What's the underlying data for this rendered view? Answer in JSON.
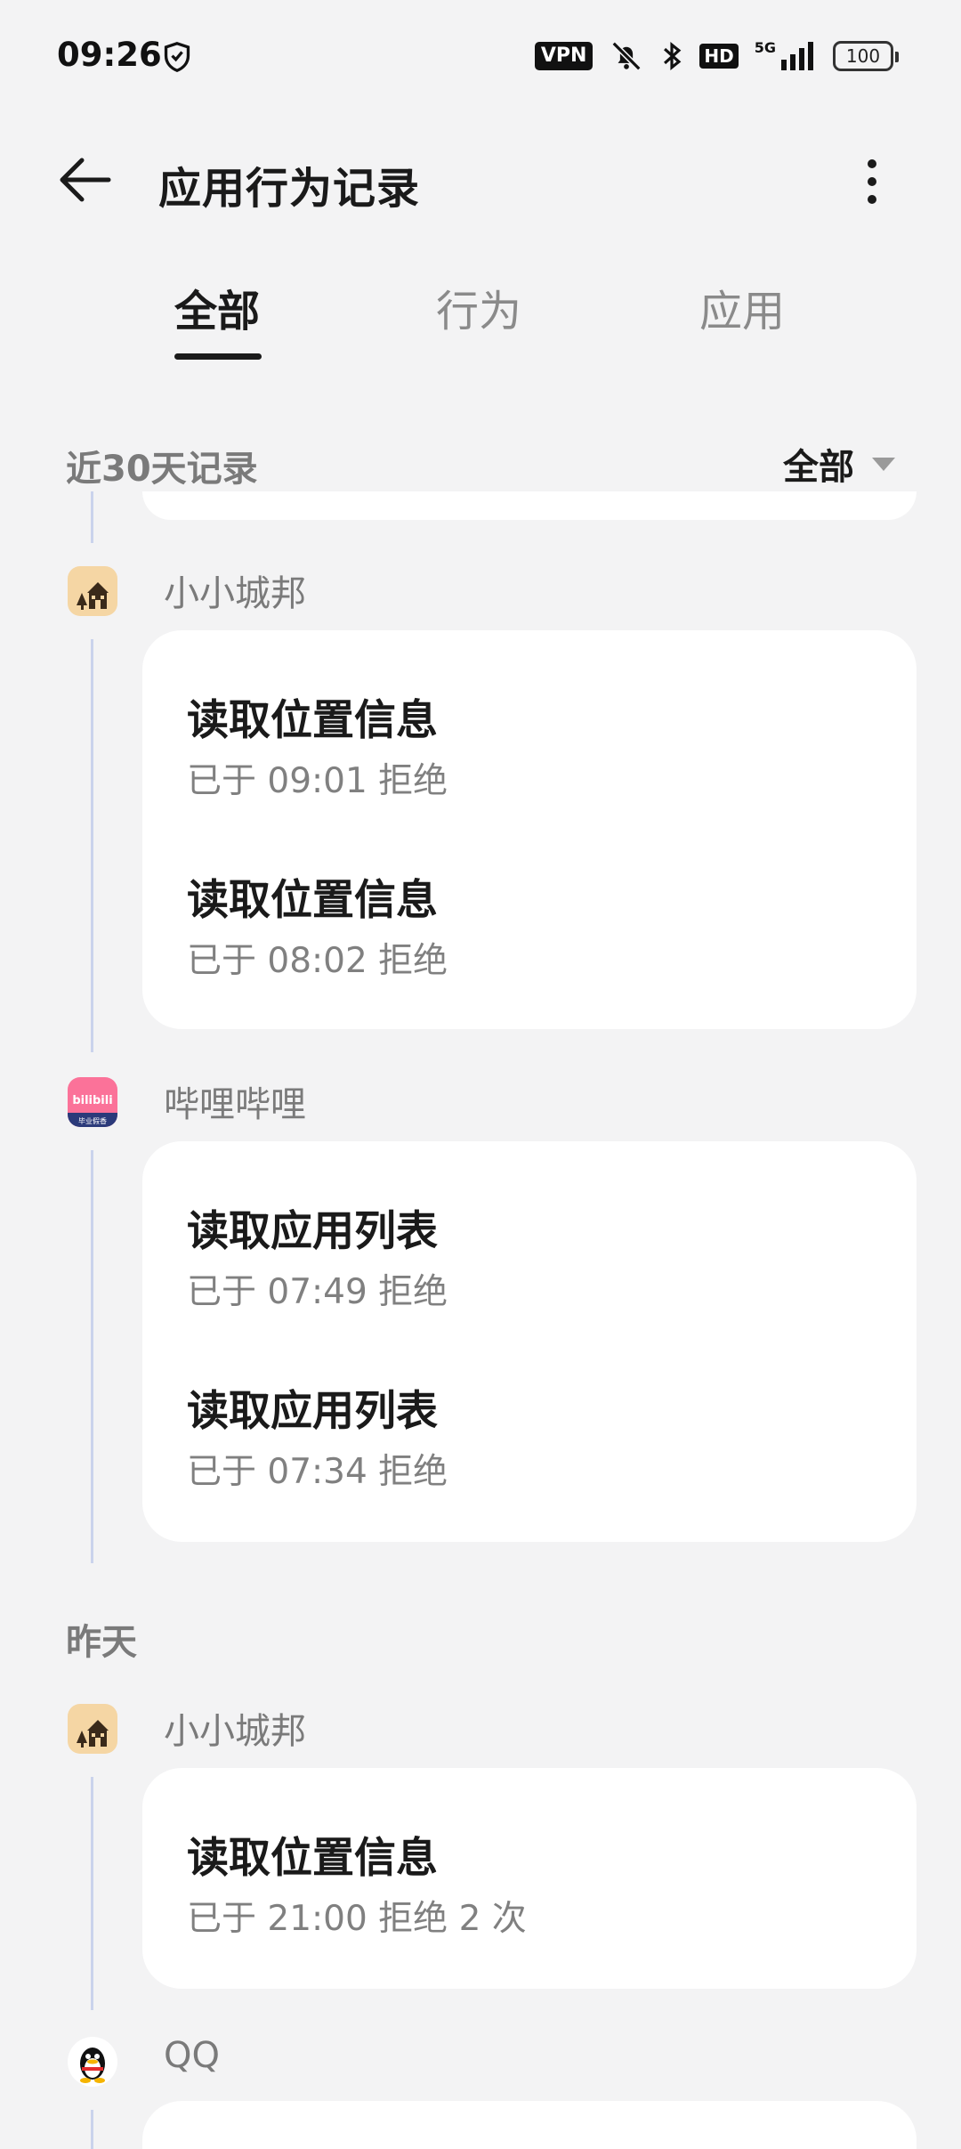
{
  "status_bar": {
    "time": "09:26",
    "vpn_label": "VPN",
    "hd_label": "HD",
    "network_label": "5G",
    "battery": "100"
  },
  "header": {
    "title": "应用行为记录"
  },
  "tabs": [
    {
      "label": "全部",
      "active": true
    },
    {
      "label": "行为",
      "active": false
    },
    {
      "label": "应用",
      "active": false
    }
  ],
  "filter": {
    "range_label": "近30天记录",
    "selected": "全部"
  },
  "groups": [
    {
      "app": "小小城邦",
      "records": [
        {
          "title": "读取位置信息",
          "detail": "已于 09:01 拒绝"
        },
        {
          "title": "读取位置信息",
          "detail": "已于 08:02 拒绝"
        }
      ]
    },
    {
      "app": "哔哩哔哩",
      "records": [
        {
          "title": "读取应用列表",
          "detail": "已于 07:49 拒绝"
        },
        {
          "title": "读取应用列表",
          "detail": "已于 07:34 拒绝"
        }
      ]
    }
  ],
  "yesterday": {
    "label": "昨天",
    "groups": [
      {
        "app": "小小城邦",
        "records": [
          {
            "title": "读取位置信息",
            "detail": "已于 21:00 拒绝 2 次"
          }
        ]
      },
      {
        "app": "QQ",
        "records": []
      }
    ]
  },
  "icons": {
    "bilibili_text": "bilibili",
    "bilibili_sub": "毕业假香"
  },
  "colors": {
    "timeline": "#cad3ec",
    "bilibili": "#fb7299",
    "city_icon_bg": "#f5d6a4"
  }
}
